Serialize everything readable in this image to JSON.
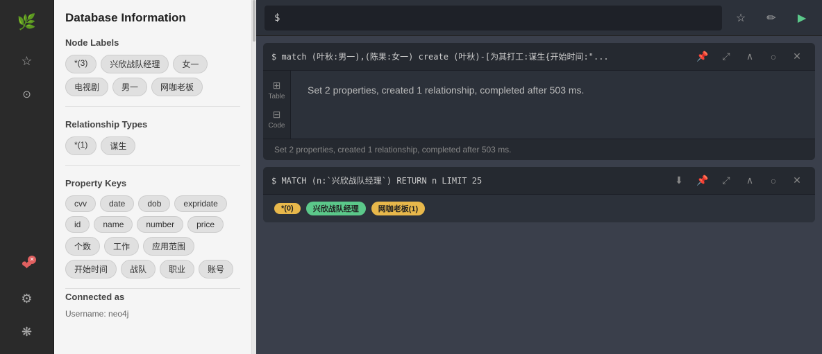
{
  "iconBar": {
    "logo": "🌿",
    "icons": [
      {
        "name": "star-icon",
        "glyph": "☆",
        "active": false
      },
      {
        "name": "search-icon",
        "glyph": "⊙",
        "active": false
      },
      {
        "name": "error-icon",
        "glyph": "⊗",
        "active": false
      },
      {
        "name": "settings-icon",
        "glyph": "⚙",
        "active": false
      },
      {
        "name": "bulb-icon",
        "glyph": "❋",
        "active": false
      }
    ]
  },
  "sidebar": {
    "title": "Database Information",
    "sections": [
      {
        "name": "Node Labels",
        "tags": [
          "*(3)",
          "兴欣战队经理",
          "女一",
          "电视剧",
          "男一",
          "网咖老板"
        ]
      },
      {
        "name": "Relationship Types",
        "tags": [
          "*(1)",
          "谋生"
        ]
      },
      {
        "name": "Property Keys",
        "tags": [
          "cvv",
          "date",
          "dob",
          "expridate",
          "id",
          "name",
          "number",
          "price",
          "个数",
          "工作",
          "应用范围",
          "开始时间",
          "战队",
          "职业",
          "账号"
        ]
      },
      {
        "name": "Connected as",
        "content": "Username: neo4j"
      }
    ]
  },
  "cmdBar": {
    "dollar": "$",
    "placeholder": "",
    "buttons": [
      {
        "name": "favorite-btn",
        "glyph": "☆"
      },
      {
        "name": "edit-btn",
        "glyph": "✏"
      },
      {
        "name": "run-btn",
        "glyph": "▶"
      }
    ]
  },
  "panels": [
    {
      "id": "panel1",
      "query": "$ match (叶秋:男一),(陈果:女一) create (叶秋)-[为其打工:谋生{开始时间:\"...",
      "sideTabs": [
        {
          "label": "Table",
          "icon": "⊞"
        },
        {
          "label": "Code",
          "icon": "⊟"
        }
      ],
      "content": "Set 2 properties, created 1 relationship, completed after 503 ms.",
      "footer": "Set 2 properties, created 1 relationship, completed after 503 ms.",
      "buttons": [
        {
          "name": "pin-btn",
          "glyph": "📌"
        },
        {
          "name": "expand-btn",
          "glyph": "⤢"
        },
        {
          "name": "up-btn",
          "glyph": "∧"
        },
        {
          "name": "refresh-btn",
          "glyph": "○"
        },
        {
          "name": "close-btn",
          "glyph": "✕"
        }
      ]
    },
    {
      "id": "panel2",
      "query": "$ MATCH (n:`兴欣战队经理`) RETURN n LIMIT 25",
      "buttons": [
        {
          "name": "download-btn",
          "glyph": "⬇"
        },
        {
          "name": "pin-btn2",
          "glyph": "📌"
        },
        {
          "name": "expand-btn2",
          "glyph": "⤢"
        },
        {
          "name": "up-btn2",
          "glyph": "∧"
        },
        {
          "name": "refresh-btn2",
          "glyph": "○"
        },
        {
          "name": "close-btn2",
          "glyph": "✕"
        }
      ]
    }
  ]
}
